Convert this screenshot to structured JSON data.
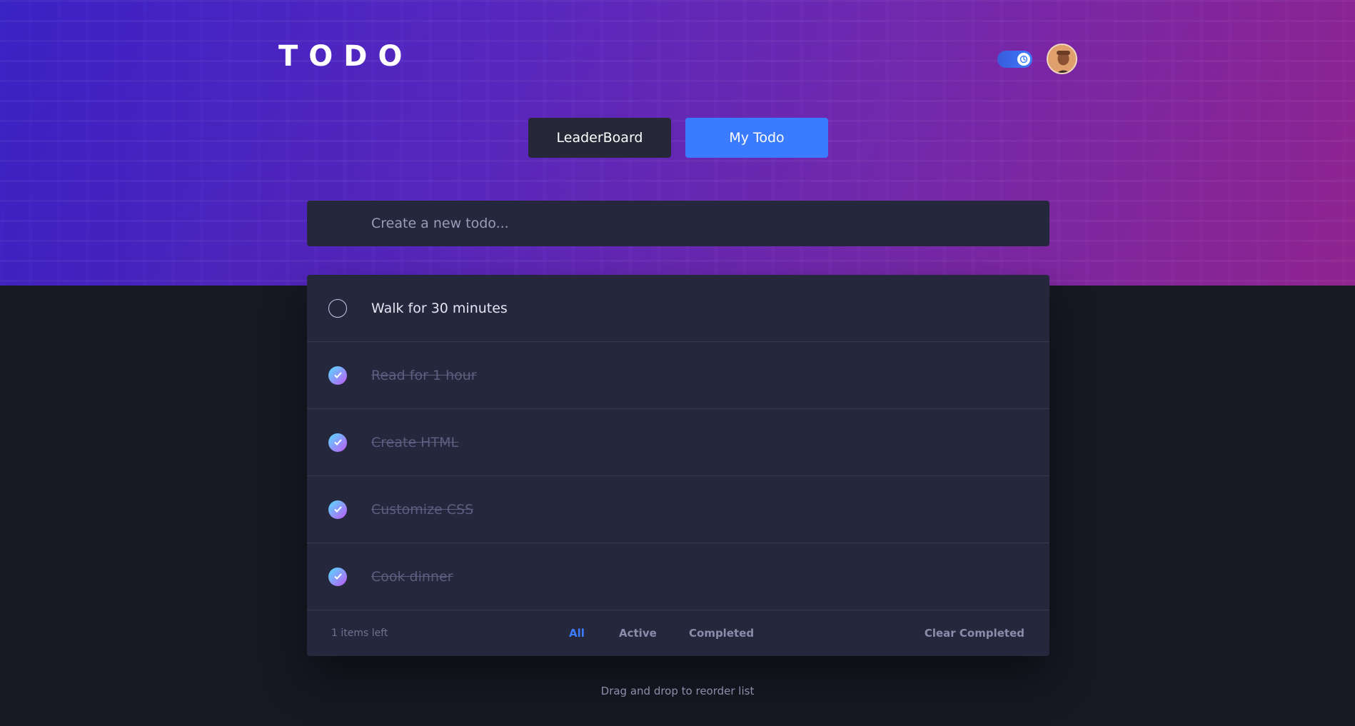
{
  "header": {
    "logo": "TODO",
    "theme_toggle_icon": "moon-icon",
    "avatar_icon": "user-avatar"
  },
  "tabs": [
    {
      "label": "LeaderBoard",
      "active": false
    },
    {
      "label": "My Todo",
      "active": true
    }
  ],
  "new_todo": {
    "placeholder": "Create a new todo...",
    "value": ""
  },
  "todos": [
    {
      "text": "Walk for 30 minutes",
      "completed": false
    },
    {
      "text": "Read for 1 hour",
      "completed": true
    },
    {
      "text": "Create HTML",
      "completed": true
    },
    {
      "text": "Customize CSS",
      "completed": true
    },
    {
      "text": "Cook dinner",
      "completed": true
    }
  ],
  "footer": {
    "items_left": "1 items left",
    "filters": [
      "All",
      "Active",
      "Completed"
    ],
    "active_filter": "All",
    "clear_label": "Clear Completed"
  },
  "hint": "Drag and drop to reorder list",
  "colors": {
    "accent": "#3a7bff",
    "check_gradient_start": "#55ddff",
    "check_gradient_end": "#c058f3",
    "background": "#171823",
    "card": "#25273d"
  }
}
